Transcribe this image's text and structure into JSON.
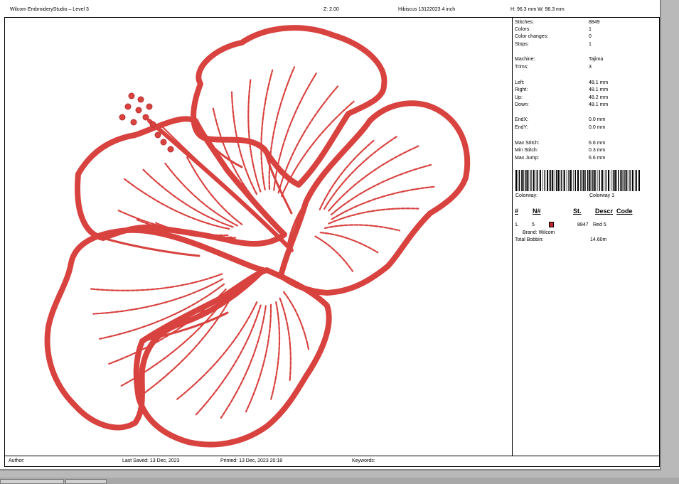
{
  "header": {
    "app_title": "Wilcom EmbroideryStudio – Level 3",
    "zoom": "Z: 2.00",
    "design_name": "Hibiscus 13122023 4 inch",
    "size": "H: 96.3 mm   W: 96.3 mm"
  },
  "stats": [
    {
      "label": "Stitches:",
      "value": "8849"
    },
    {
      "label": "Colors:",
      "value": "1"
    },
    {
      "label": "Color changes:",
      "value": "0"
    },
    {
      "label": "Stops:",
      "value": "1"
    },
    {
      "label": "Machine:",
      "value": "Tajima"
    },
    {
      "label": "Trims:",
      "value": "3"
    },
    {
      "label": "Left:",
      "value": "48.1 mm"
    },
    {
      "label": "Right:",
      "value": "48.1 mm"
    },
    {
      "label": "Up:",
      "value": "48.2 mm"
    },
    {
      "label": "Down:",
      "value": "48.1 mm"
    },
    {
      "label": "EndX:",
      "value": "0.0 mm"
    },
    {
      "label": "EndY:",
      "value": "0.0 mm"
    },
    {
      "label": "Max Stitch:",
      "value": "6.6 mm"
    },
    {
      "label": "Min Stitch:",
      "value": "0.3 mm"
    },
    {
      "label": "Max Jump:",
      "value": "6.6 mm"
    }
  ],
  "colorway": {
    "label": "Colorway:",
    "value": "Colorway 1"
  },
  "color_table": {
    "headers": {
      "num": "#",
      "needle": "N#",
      "stitches": "St.",
      "descr": "Descr",
      "code": "Code"
    },
    "rows": [
      {
        "num": "1.",
        "needle": "5",
        "stitches": "8847",
        "descr": "Red 5",
        "color": "#c0262a"
      }
    ],
    "brand": "Brand: Wilcom",
    "bobbin_label": "Total Bobbin:",
    "bobbin_value": "14.60m"
  },
  "footer": {
    "author": "Author:",
    "last_saved": "Last Saved: 13 Dec, 2023",
    "printed": "Printed: 13 Dec, 2023 20:18",
    "keywords": "Keywords:"
  },
  "colors": {
    "thread": "#d8423f",
    "thread_dark": "#b8302e"
  }
}
